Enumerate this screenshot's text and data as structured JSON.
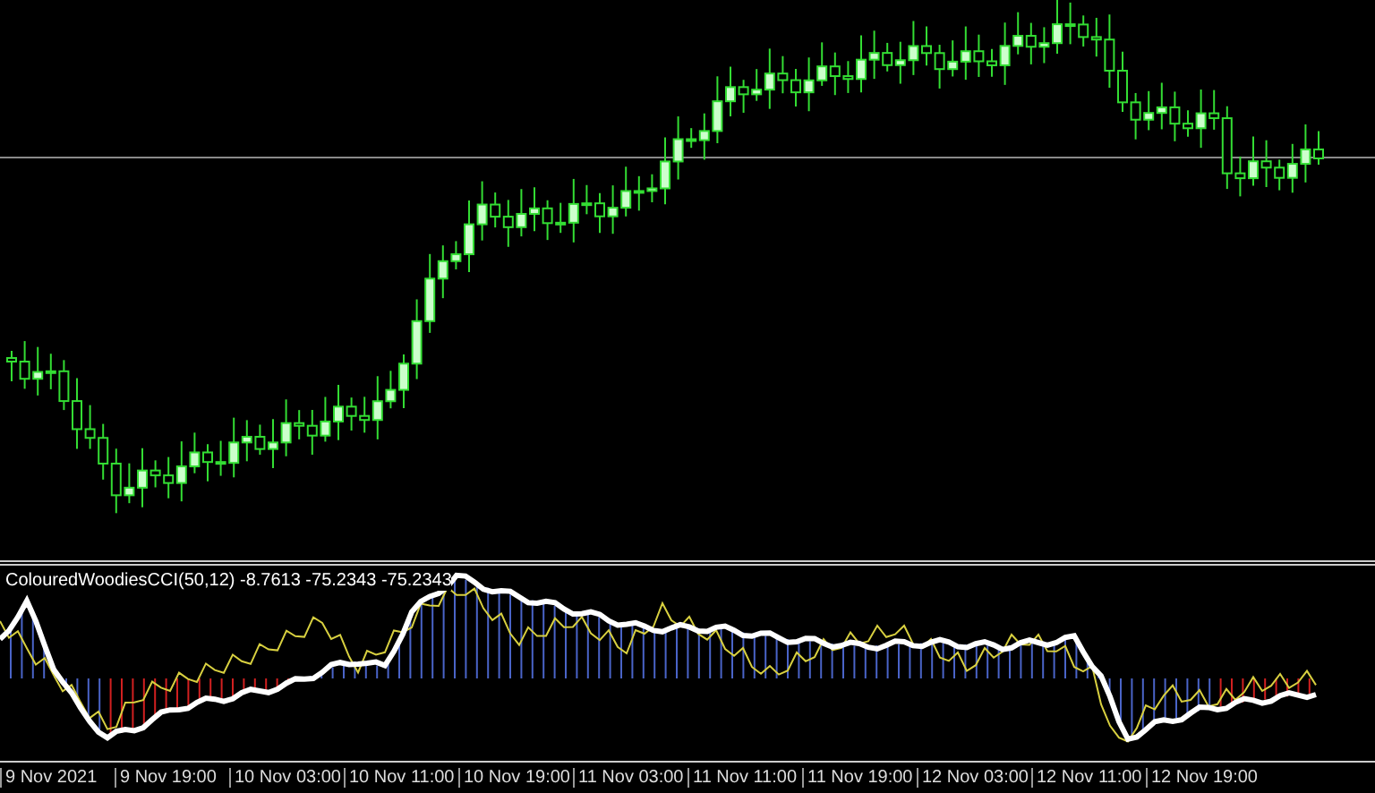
{
  "indicator": {
    "label": "ColouredWoodiesCCI(50,12) -8.7613 -75.2343 -75.2343"
  },
  "time_axis": {
    "labels": [
      "9 Nov 2021",
      "9 Nov 19:00",
      "10 Nov 03:00",
      "10 Nov 11:00",
      "10 Nov 19:00",
      "11 Nov 03:00",
      "11 Nov 11:00",
      "11 Nov 19:00",
      "12 Nov 03:00",
      "12 Nov 11:00",
      "12 Nov 19:00"
    ]
  }
}
